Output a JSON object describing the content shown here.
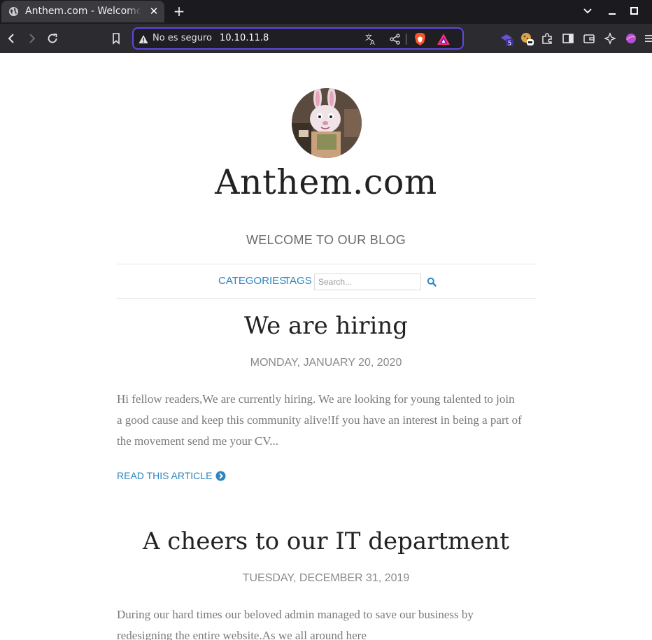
{
  "browser": {
    "tab_title": "Anthem.com - Welcome to our blog",
    "tab_close": "✕",
    "new_tab": "+",
    "security_label": "No es seguro",
    "url": "10.10.11.8",
    "extension_badge": "5",
    "accent_color": "#5b4ae0"
  },
  "site": {
    "title": "Anthem.com",
    "tagline": "WELCOME TO OUR BLOG",
    "nav": {
      "categories": "CATEGORIES",
      "tags": "TAGS",
      "search_placeholder": "Search..."
    },
    "link_color": "#2c86c0"
  },
  "posts": [
    {
      "title": "We are hiring",
      "date": "MONDAY, JANUARY 20, 2020",
      "excerpt": "Hi fellow readers,We are currently hiring. We are looking for young talented to join a good cause and keep this community alive!If you have an interest in being a part of the movement send me your CV...",
      "read_more": "READ THIS ARTICLE"
    },
    {
      "title": "A cheers to our IT department",
      "date": "TUESDAY, DECEMBER 31, 2019",
      "excerpt": "During our hard times our beloved admin managed to save our business by redesigning the entire website.As we all around here"
    }
  ]
}
